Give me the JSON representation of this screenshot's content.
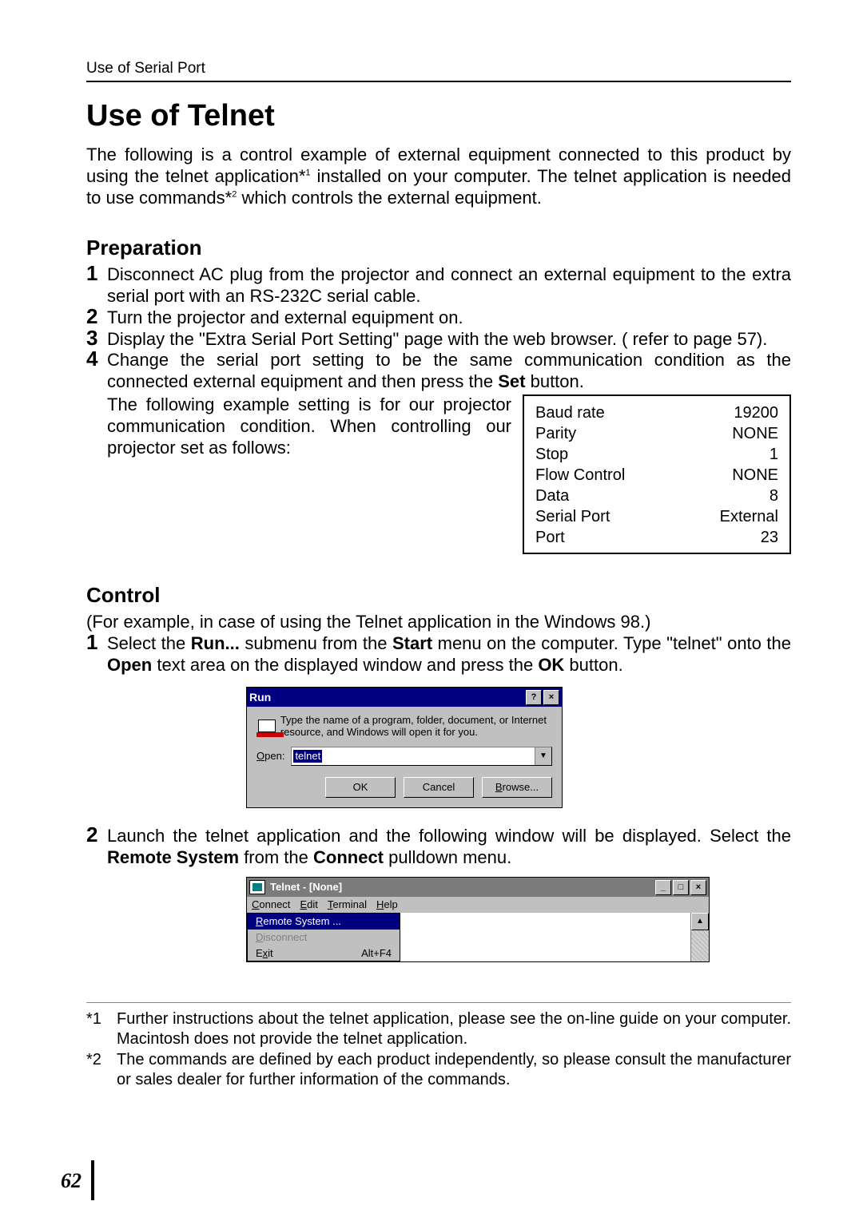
{
  "header": "Use of Serial Port",
  "title": "Use of Telnet",
  "intro": {
    "p1a": "The following is a control example of external equipment connected to this product by using the telnet application*",
    "sup1": "1",
    "p1b": " installed on your computer. The telnet application is needed to use commands*",
    "sup2": "2",
    "p1c": " which controls the external equipment."
  },
  "prep": {
    "heading": "Preparation",
    "s1": "Disconnect AC plug from the projector and connect an external equipment to the extra serial port with an RS-232C serial cable.",
    "s2": "Turn the projector and external equipment on.",
    "s3": "Display the \"Extra Serial Port Setting\" page with the web browser. ( refer to page 57).",
    "s4a": "Change the serial port setting to be the same communication condition as the connected external equipment and then press the ",
    "s4set": "Set",
    "s4b": " button.",
    "s4c": "The following example setting is for our projector communication condition. When controlling our projector set as follows:"
  },
  "settings": [
    {
      "k": "Baud rate",
      "v": "19200"
    },
    {
      "k": "Parity",
      "v": "NONE"
    },
    {
      "k": "Stop",
      "v": "1"
    },
    {
      "k": "Flow Control",
      "v": "NONE"
    },
    {
      "k": "Data",
      "v": "8"
    },
    {
      "k": "Serial Port",
      "v": "External"
    },
    {
      "k": "Port",
      "v": "23"
    }
  ],
  "control": {
    "heading": "Control",
    "intro": "(For example, in case of using the Telnet application in the Windows 98.)",
    "s1a": "Select the ",
    "s1run": "Run...",
    "s1b": " submenu from the ",
    "s1start": "Start",
    "s1c": " menu on the computer. Type \"telnet\" onto the ",
    "s1open": "Open",
    "s1d": " text area on the displayed window and press the ",
    "s1ok": "OK",
    "s1e": " button.",
    "s2a": "Launch the telnet application and the following window will be displayed. Select the ",
    "s2rs": "Remote System",
    "s2b": " from the ",
    "s2conn": "Connect",
    "s2c": " pulldown menu."
  },
  "run_dialog": {
    "title": "Run",
    "desc": "Type the name of a program, folder, document, or Internet resource, and Windows will open it for you.",
    "open_lbl_u": "O",
    "open_lbl": "pen:",
    "value": "telnet",
    "ok": "OK",
    "cancel": "Cancel",
    "browse_u": "B",
    "browse": "rowse..."
  },
  "telnet": {
    "title": "Telnet - [None]",
    "menu": {
      "c_u": "C",
      "c": "onnect",
      "e_u": "E",
      "e": "dit",
      "t_u": "T",
      "t": "erminal",
      "h_u": "H",
      "h": "elp"
    },
    "pd": {
      "rs_u": "R",
      "rs": "emote System ...",
      "dis_u": "D",
      "dis": "isconnect",
      "ex_u": "x",
      "ex_pre": "E",
      "ex_post": "it",
      "short": "Alt+F4"
    }
  },
  "footnotes": {
    "m1": "*1",
    "t1": "Further instructions about the telnet application, please see the on-line guide on your computer. Macintosh does not provide the telnet application.",
    "m2": "*2",
    "t2": "The commands are defined by each product independently, so please consult the manufacturer or sales dealer for further information of the commands."
  },
  "page_number": "62"
}
